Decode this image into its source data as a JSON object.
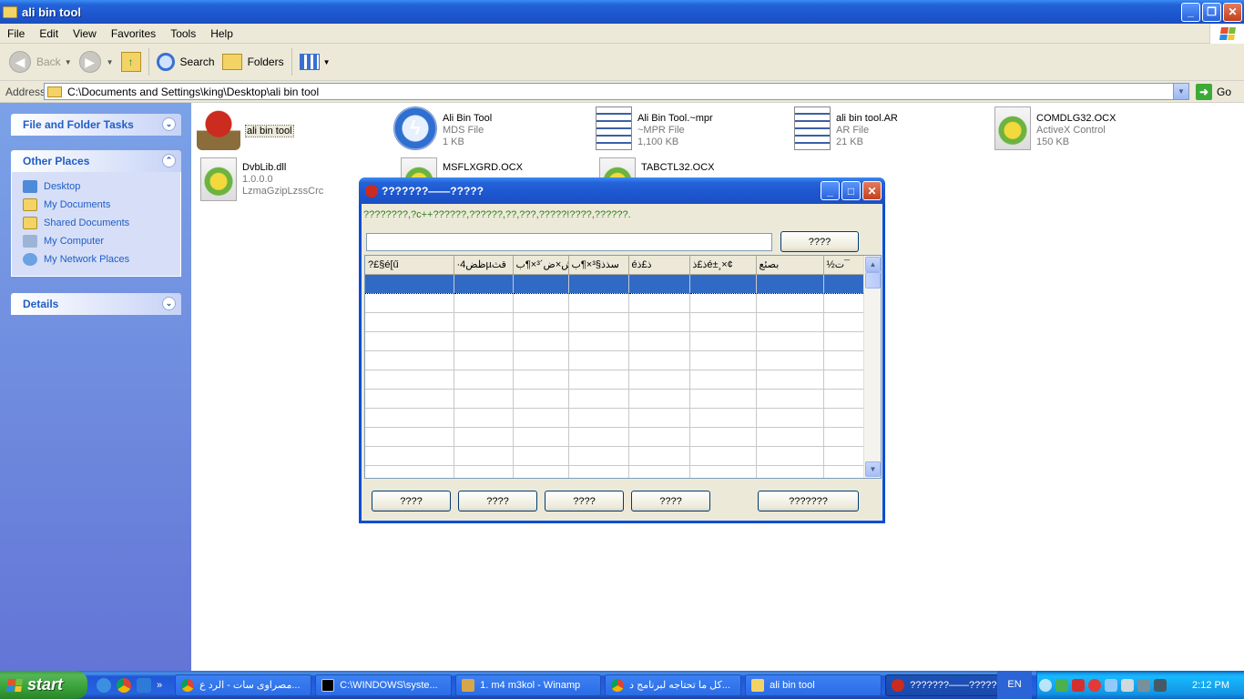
{
  "window": {
    "title": "ali bin tool"
  },
  "menu": [
    "File",
    "Edit",
    "View",
    "Favorites",
    "Tools",
    "Help"
  ],
  "toolbar": {
    "back": "Back",
    "search": "Search",
    "folders": "Folders"
  },
  "address": {
    "label": "Address",
    "path": "C:\\Documents and Settings\\king\\Desktop\\ali bin tool",
    "go": "Go"
  },
  "tasks": {
    "file_folder_tasks": "File and Folder Tasks",
    "other_places": "Other Places",
    "places": [
      "Desktop",
      "My Documents",
      "Shared Documents",
      "My Computer",
      "My Network Places"
    ],
    "details": "Details"
  },
  "files": [
    {
      "name": "ali bin tool",
      "type": "",
      "size": "",
      "icon": "helmet-app-icon"
    },
    {
      "name": "Ali Bin Tool",
      "type": "MDS File",
      "size": "1 KB",
      "icon": "bolt-icon"
    },
    {
      "name": "Ali Bin Tool.~mpr",
      "type": "~MPR File",
      "size": "1,100 KB",
      "icon": "document-icon"
    },
    {
      "name": "ali bin tool.AR",
      "type": "AR File",
      "size": "21 KB",
      "icon": "document-icon"
    },
    {
      "name": "COMDLG32.OCX",
      "type": "ActiveX Control",
      "size": "150 KB",
      "icon": "gear-icon"
    },
    {
      "name": "DvbLib.dll",
      "type": "1.0.0.0",
      "size": "LzmaGzipLzssCrc",
      "icon": "gear-icon"
    },
    {
      "name": "MSFLXGRD.OCX",
      "type": "",
      "size": "",
      "icon": "gear-icon"
    },
    {
      "name": "TABCTL32.OCX",
      "type": "",
      "size": "",
      "icon": "gear-icon"
    }
  ],
  "dialog": {
    "title": "???????——?????",
    "message": "????????,?c++??????,??????,??,???,?????!????,??????.",
    "search_button": "????",
    "columns": [
      "?£§é[ű",
      "·ظض4µقث",
      "ش×ض´³×¶ب",
      "سذذ§³×¶ب",
      "éذ£ذ",
      "ذ£ذé±¸×¢",
      "بصئع",
      "½ت¯"
    ],
    "buttons": [
      "????",
      "????",
      "????",
      "????"
    ],
    "exit_button": "???????"
  },
  "taskbar": {
    "start": "start",
    "tasks": [
      {
        "label": "مصراوى سات - الرد ع...",
        "icon": "chrome-icon"
      },
      {
        "label": "C:\\WINDOWS\\syste...",
        "icon": "cmd-icon"
      },
      {
        "label": "1. m4 m3kol - Winamp",
        "icon": "winamp-icon"
      },
      {
        "label": "كل ما تحتاجه لبرنامج د...",
        "icon": "chrome-icon"
      },
      {
        "label": "ali bin tool",
        "icon": "folder-icon"
      },
      {
        "label": "???????——?????",
        "icon": "helmet-app-icon"
      }
    ],
    "lang": "EN",
    "clock": "2:12 PM"
  }
}
